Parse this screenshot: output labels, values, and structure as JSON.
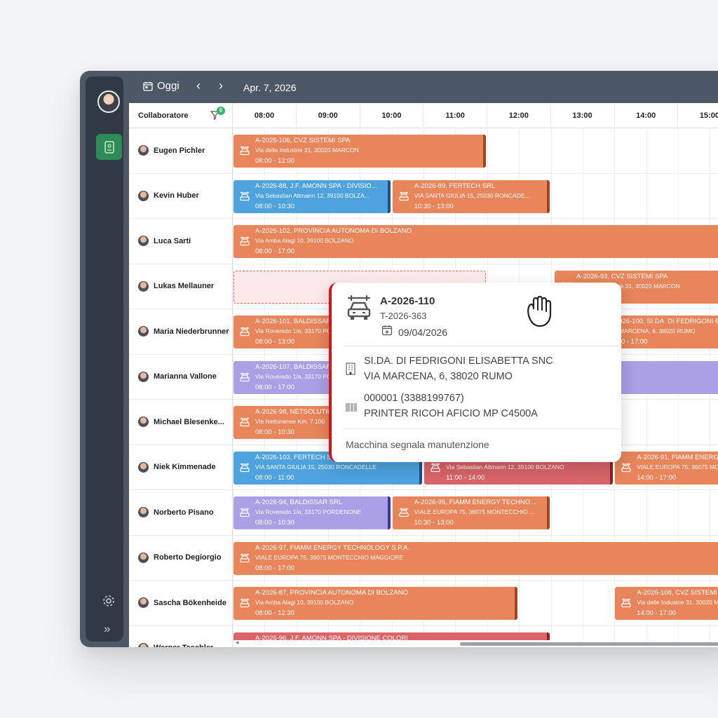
{
  "topbar": {
    "today_label": "Oggi",
    "prev": "‹",
    "next": "›",
    "date": "Apr. 7, 2026"
  },
  "sidebar": {
    "expand_glyph": "»"
  },
  "grid": {
    "resource_header": "Collaboratore",
    "filter_count": "0",
    "hours": [
      "08:00",
      "09:00",
      "10:00",
      "11:00",
      "12:00",
      "13:00",
      "14:00",
      "15:00"
    ]
  },
  "resources": [
    {
      "name": "Eugen Pichler"
    },
    {
      "name": "Kevin Huber"
    },
    {
      "name": "Luca Sarti"
    },
    {
      "name": "Lukas Mellauner"
    },
    {
      "name": "Maria Niederbrunner"
    },
    {
      "name": "Marianna Vallone"
    },
    {
      "name": "Michael Blesenke..."
    },
    {
      "name": "Niek Kimmenade"
    },
    {
      "name": "Norberto Pisano"
    },
    {
      "name": "Roberto Degiorgio"
    },
    {
      "name": "Sascha Bökenheide"
    },
    {
      "name": "Werner Taschler"
    }
  ],
  "events": [
    {
      "row": 0,
      "color": "orange",
      "start": 8,
      "end": 12,
      "title": "A-2026-106, CVZ SISTEMI SPA",
      "address": "Via delle Industrie 31, 30020 MARCON",
      "time": "08:00 - 12:00"
    },
    {
      "row": 1,
      "color": "blue",
      "start": 8,
      "end": 10.5,
      "title": "A-2026-88, J.F. AMONN SPA - DIVISIO...",
      "address": "Via Sebastian Altmann 12, 39100 BOLZA...",
      "time": "08:00 - 10:30"
    },
    {
      "row": 1,
      "color": "orange",
      "start": 10.5,
      "end": 13,
      "title": "A-2026-89, FERTECH SRL",
      "address": "VIA SANTA GIULIA 15, 25030 RONCADE...",
      "time": "10:30 - 13:00"
    },
    {
      "row": 2,
      "color": "orange",
      "start": 8,
      "end": 17,
      "title": "A-2026-102, PROVINCIA AUTONOMA DI BOLZANO",
      "address": "Via Amba Alagi 10, 39100 BOLZANO",
      "time": "08:00 - 17:00"
    },
    {
      "row": 3,
      "color": "ghost",
      "start": 8,
      "end": 12,
      "title": "",
      "address": "",
      "time": ""
    },
    {
      "row": 3,
      "color": "orange",
      "start": 13.05,
      "end": 17,
      "title": "A-2026-93, CVZ SISTEMI SPA",
      "address": "Via delle Industrie 31, 30020 MARCON",
      "time": "14:00 - 17:00"
    },
    {
      "row": 4,
      "color": "orange",
      "start": 8,
      "end": 13,
      "title": "A-2026-101, BALDISSAR SRL",
      "address": "Via Roveredo 1/a, 33170 PORDENONE",
      "time": "08:00 - 13:00"
    },
    {
      "row": 4,
      "color": "orange",
      "start": 13.55,
      "end": 17,
      "title": "A-2026-100, SI.DA. DI FEDRIGONI E",
      "address": "VIA MARCENA, 6, 38020 RUMO",
      "time": "13:30 - 17:00"
    },
    {
      "row": 5,
      "color": "purple",
      "start": 8,
      "end": 17,
      "title": "A-2026-107, BALDISSAR SRL",
      "address": "Via Roveredo 1/a, 33170 PORDENONE",
      "time": "08:00 - 17:00"
    },
    {
      "row": 6,
      "color": "orange",
      "start": 8,
      "end": 10.5,
      "title": "A-2026-98, NETSOLUTIONS",
      "address": "Via Nettunense Km. 7.100",
      "time": "08:00 - 10:30"
    },
    {
      "row": 7,
      "color": "blue",
      "start": 8,
      "end": 11,
      "title": "A-2026-103, FERTECH SRL",
      "address": "VIA SANTA GIULIA 15, 25030 RONCADELLE",
      "time": "08:00 - 11:00"
    },
    {
      "row": 7,
      "color": "red",
      "start": 11,
      "end": 14,
      "title": "A-2026-99, J.F. AMONN SPA",
      "address": "Via Sebastian Altmann 12, 39100 BOLZANO",
      "time": "11:00 - 14:00"
    },
    {
      "row": 7,
      "color": "orange",
      "start": 14,
      "end": 17,
      "title": "A-2026-91, FIAMM ENERGY",
      "address": "VIALE EUROPA 75, 36075 MONTECCHIO",
      "time": "14:00 - 17:00"
    },
    {
      "row": 8,
      "color": "purple",
      "start": 8,
      "end": 10.5,
      "title": "A-2026-94, BALDISSAR SRL",
      "address": "Via Roveredo 1/a, 33170 PORDENONE",
      "time": "08:00 - 10:30"
    },
    {
      "row": 8,
      "color": "orange",
      "start": 10.5,
      "end": 13,
      "title": "A-2026-95, FIAMM ENERGY TECHNO...",
      "address": "VIALE EUROPA 75, 36075 MONTECCHIO ...",
      "time": "10:30 - 13:00"
    },
    {
      "row": 9,
      "color": "orange",
      "start": 8,
      "end": 17,
      "title": "A-2026-97, FIAMM ENERGY TECHNOLOGY S.P.A.",
      "address": "VIALE EUROPA 75, 36075 MONTECCHIO MAGGIORE",
      "time": "08:00 - 17:00"
    },
    {
      "row": 10,
      "color": "orange",
      "start": 8,
      "end": 12.5,
      "title": "A-2026-87, PROVINCIA AUTONOMA DI BOLZANO",
      "address": "Via Amba Alagi 10, 39100 BOLZANO",
      "time": "08:00 - 12:30"
    },
    {
      "row": 10,
      "color": "orange",
      "start": 14,
      "end": 17,
      "title": "A-2026-108, CVZ SISTEMI SPA",
      "address": "Via delle Industrie 31, 30020 MARCON",
      "time": "14:00 - 17:00"
    },
    {
      "row": 11,
      "color": "red",
      "start": 8,
      "end": 13,
      "title": "A-2026-96, J.F. AMONN SPA - DIVISIONE COLORI",
      "address": "",
      "time": ""
    }
  ],
  "popup": {
    "title": "A-2026-110",
    "subtitle": "T-2026-363",
    "date": "09/04/2026",
    "company": "SI.DA. DI FEDRIGONI ELISABETTA SNC",
    "address": "VIA MARCENA, 6, 38020 RUMO",
    "serial": "000001 (3388199767)",
    "device": "PRINTER RICOH AFICIO MP C4500A",
    "note": "Macchina segnala manutenzione",
    "accent": "#d8141b"
  },
  "colors": {
    "orange": "#e8855a",
    "blue": "#4ea3df",
    "purple": "#ab9fe6",
    "red": "#d96568",
    "frame": "#4c5866",
    "active": "#2e8b57"
  }
}
